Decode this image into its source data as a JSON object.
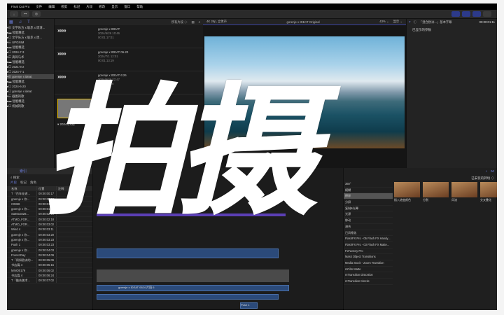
{
  "menubar": {
    "items": [
      "Final Cut Pro",
      "文件",
      "编辑",
      "修剪",
      "标记",
      "片段",
      "修改",
      "显示",
      "窗口",
      "帮助"
    ]
  },
  "toolbar": {
    "buttons": [
      "↓",
      "⊶",
      "◎"
    ]
  },
  "library": {
    "items": [
      {
        "label": "▾☷ 文学乐方 x 联赤 x 周清...",
        "sel": false
      },
      {
        "label": "  ▸▬ 智能精选",
        "sel": false
      },
      {
        "label": "  ▸☐ 文学乐方 x 联赤 x 周...",
        "sel": false
      },
      {
        "label": "▾☷ UPGNIM",
        "sel": false
      },
      {
        "label": "  ▸▬ 智能精选",
        "sel": false
      },
      {
        "label": "  ▸☐ 2024-7-3",
        "sel": false
      },
      {
        "label": "▾☷ 高风马术",
        "sel": false
      },
      {
        "label": "  ▸▬ 智能精选",
        "sel": false
      },
      {
        "label": "  ▸☐ 2021-8-2",
        "sel": false
      },
      {
        "label": "  ▸☐ 2024-7-1",
        "sel": false
      },
      {
        "label": "▾☷ gorenje x ideat",
        "sel": true
      },
      {
        "label": "  ▸▬ 智能精选",
        "sel": false
      },
      {
        "label": "  ▸☐ 2024-6-20",
        "sel": false
      },
      {
        "label": "  ▸☐ gorenje x ideat",
        "sel": false
      },
      {
        "label": "▾☷ 截图的歌",
        "sel": false
      },
      {
        "label": "  ▸▬ 智能精选",
        "sel": false
      },
      {
        "label": "  ▸☐ 机械的歌",
        "sel": false
      }
    ]
  },
  "browser": {
    "filter": "所有片段 ◇",
    "clips": [
      {
        "name": "gorenje x IDEAT",
        "date": "2024/6/26 10:46",
        "dur": "00:01:17:01"
      },
      {
        "name": "gorenje x IDEAT 06-20",
        "date": "2024/7/1 12:01",
        "dur": "00:01:13:19"
      },
      {
        "name": "gorenje x IDEAT 6:26",
        "date": "2024/6/26 22:47",
        "dur": "00:01:11:16"
      }
    ],
    "group": "▾ 2024年6月"
  },
  "viewer": {
    "format": "4K 25p, 立体声",
    "title": "gorenje x IDEAT Original",
    "zoom": "43% ⌄",
    "view": "显示 ⌄",
    "subtitle": "欧洲的go"
  },
  "inspector": {
    "title": "「混合欧洲...」基本字幕",
    "time": "00:00:01:11",
    "text": "已显示的参数"
  },
  "index": {
    "tab": "索引",
    "search": "搜索",
    "filters": [
      "片段",
      "标记",
      "角色"
    ],
    "columns": [
      "名称",
      "位置",
      "注释"
    ],
    "rows": [
      [
        "T「百年征途...",
        "00:00:00:17"
      ],
      [
        "gorenje x 你...",
        "00:00:01:16"
      ],
      [
        "C0858",
        "00:00:01:19"
      ],
      [
        "gorenje x 你...",
        "00:00:01:24"
      ],
      [
        "Sa6010328...",
        "00:00:02:16"
      ],
      [
        "ATMO_FOR...",
        "00:00:02:18"
      ],
      [
        "ATMO_FOR...",
        "00:00:03:02"
      ],
      [
        "Wind 4",
        "00:00:03:11"
      ],
      [
        "gorenje x 你...",
        "00:00:03:20"
      ],
      [
        "gorenje x 你...",
        "00:00:03:23"
      ],
      [
        "Push 1",
        "00:00:03:23"
      ],
      [
        "gorenje x 你...",
        "00:00:04:03"
      ],
      [
        "Forest Day",
        "00:00:04:09"
      ],
      [
        "T「闹如欧洲的...",
        "00:00:05:06"
      ],
      [
        "书店篇 4",
        "00:00:05:15"
      ],
      [
        "MINO0179",
        "00:00:06:02"
      ],
      [
        "书店篇 4",
        "00:00:06:24"
      ],
      [
        "T「融合美术...",
        "00:00:07:02"
      ]
    ]
  },
  "timeline": {
    "clip_name": "gorenje x IDEAT 0624 片段 6",
    "label2": "Push 1"
  },
  "effects": {
    "sort": "已安装的转场 ◇",
    "categories": [
      "360°",
      "模糊",
      "擦除",
      "分屏",
      "复制&光晕",
      "光源",
      "移动",
      "溶合",
      "已风格化",
      "FlashFX Pro - 05 Flash FX Handy...",
      "FlashFX Pro - 03 Flash FX Matte...",
      "FxFactory Pro",
      "Mask Object Transitions",
      "Media Stock - Zoom Transition",
      "mFilm Matte",
      "mTransition Distortion",
      "mTransition Kinetic"
    ],
    "selected": 2,
    "items": [
      "插入溶变颜色",
      "分割",
      "风流",
      "交叉叠化"
    ]
  },
  "overlay": {
    "text": "拍摄"
  }
}
